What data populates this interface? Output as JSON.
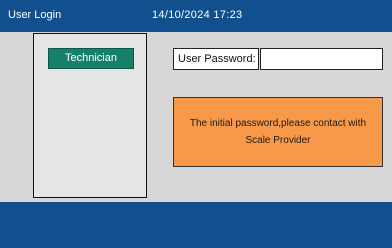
{
  "header": {
    "title": "User Login",
    "datetime": "14/10/2024 17:23"
  },
  "user_list": {
    "items": [
      {
        "label": "Technician"
      }
    ]
  },
  "password": {
    "label": "User Password:",
    "value": ""
  },
  "notice": {
    "line1": "The initial password,please contact with",
    "line2": "Scale Provider"
  },
  "colors": {
    "bar_blue": "#114f8e",
    "content_gray": "#d7d7d7",
    "selected_green": "#17806b",
    "notice_orange": "#f8994a"
  }
}
